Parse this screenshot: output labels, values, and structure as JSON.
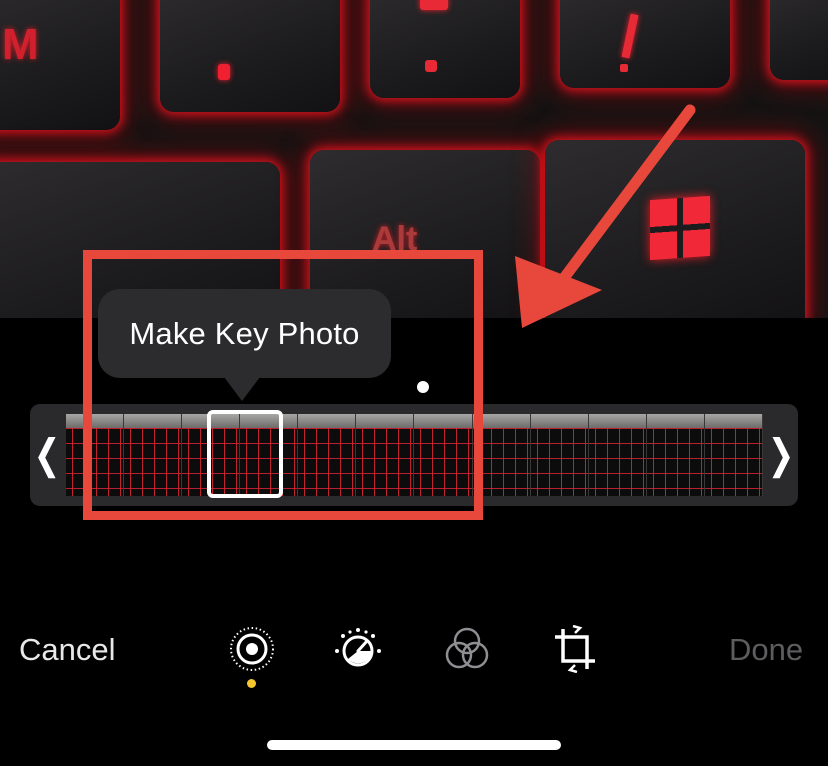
{
  "photo": {
    "key_labels": [
      "M",
      "Alt"
    ]
  },
  "tooltip": {
    "text": "Make Key Photo"
  },
  "scrubber": {
    "left_handle": "❬",
    "right_handle": "❭",
    "frame_count": 12
  },
  "toolbar": {
    "cancel_label": "Cancel",
    "done_label": "Done",
    "tools": [
      "live-photo-icon",
      "adjust-icon",
      "filters-icon",
      "crop-icon"
    ],
    "active_tool": "live-photo-icon"
  },
  "colors": {
    "annotation": "#e8483c",
    "active_indicator": "#f6c62e",
    "done_disabled": "#5d5d60",
    "tooltip_bg": "#2c2c2e"
  }
}
